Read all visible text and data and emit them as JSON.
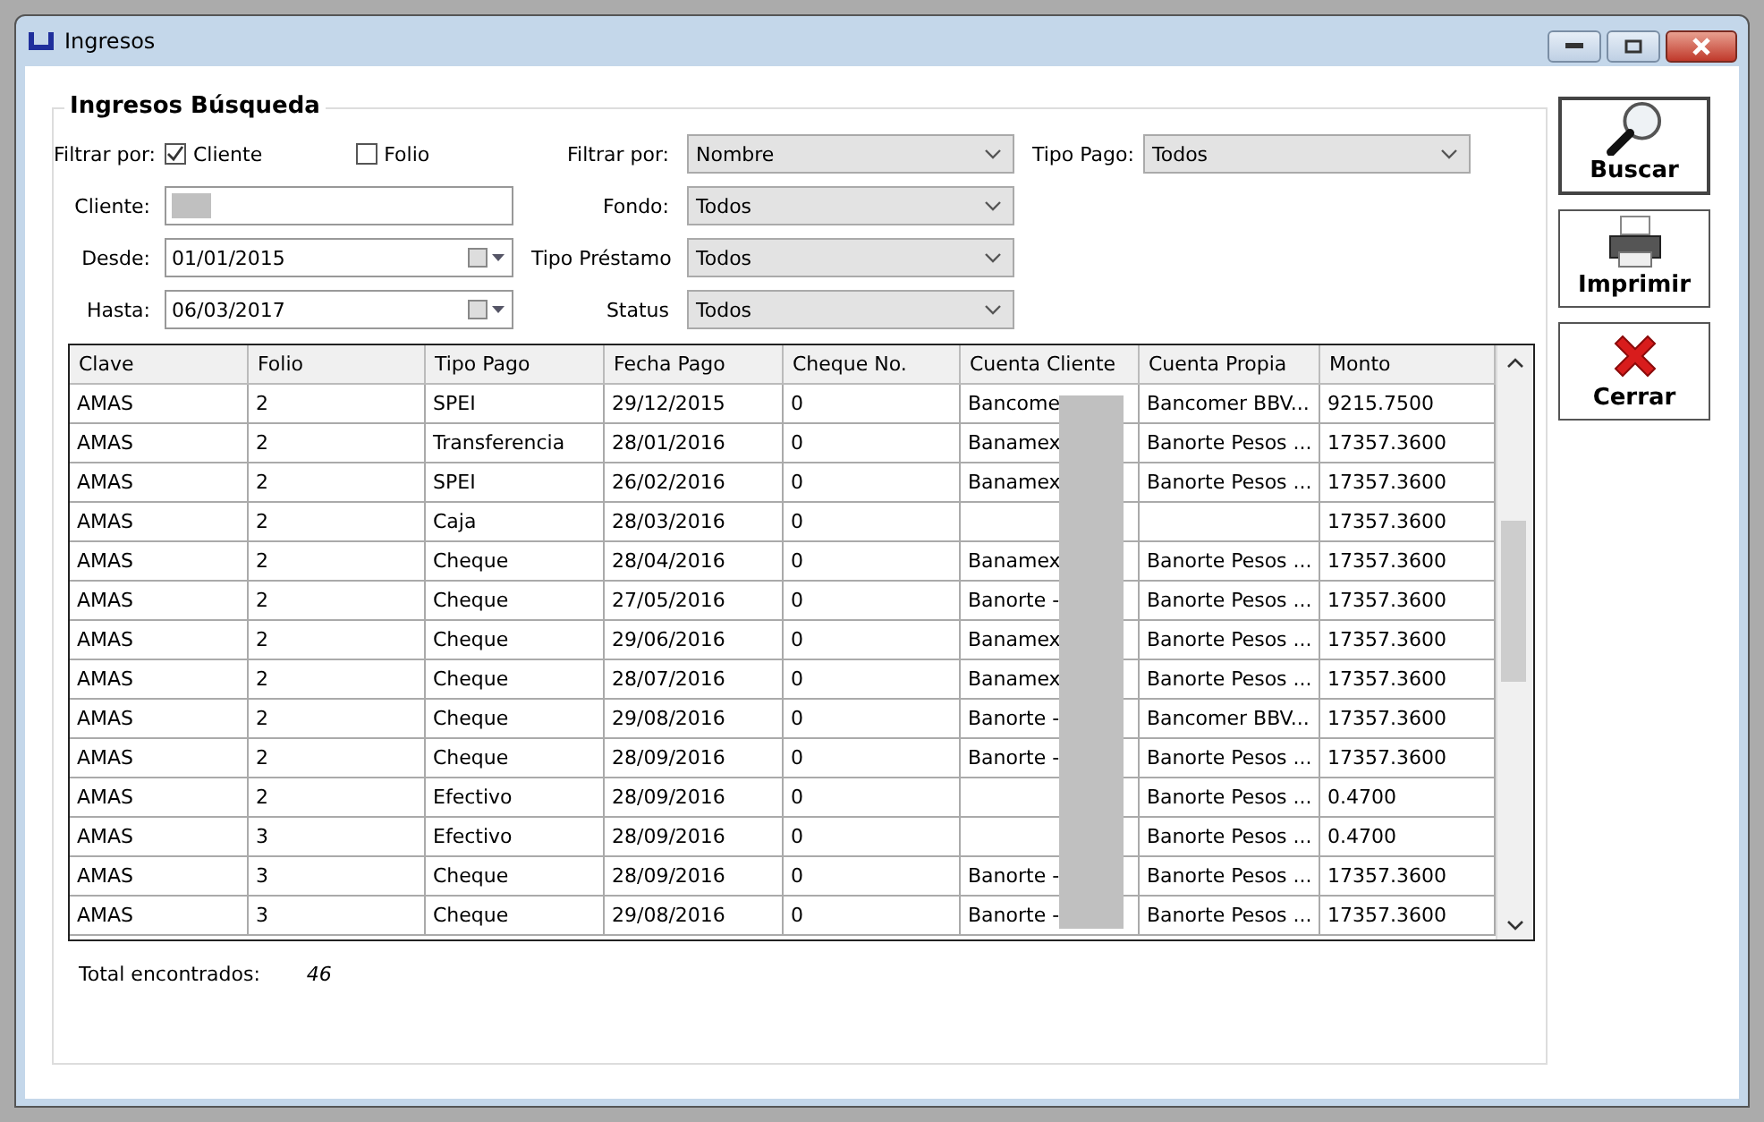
{
  "window": {
    "title": "Ingresos"
  },
  "group": {
    "title": "Ingresos Búsqueda"
  },
  "filters": {
    "filter_label": "Filtrar por:",
    "options": [
      {
        "label": "Cliente",
        "checked": true
      },
      {
        "label": "Folio",
        "checked": false
      }
    ],
    "cliente_label": "Cliente:",
    "desde_label": "Desde:",
    "desde_value": "01/01/2015",
    "hasta_label": "Hasta:",
    "hasta_value": "06/03/2017",
    "combos": [
      {
        "label": "Filtrar por:",
        "value": "Nombre"
      },
      {
        "label": "Fondo:",
        "value": "Todos"
      },
      {
        "label": "Tipo Préstamo",
        "value": "Todos"
      },
      {
        "label": "Status",
        "value": "Todos"
      }
    ],
    "tipo_pago": {
      "label": "Tipo Pago:",
      "value": "Todos"
    }
  },
  "table": {
    "columns": [
      "Clave",
      "Folio",
      "Tipo Pago",
      "Fecha Pago",
      "Cheque No.",
      "Cuenta Cliente",
      "Cuenta Propia",
      "Monto"
    ],
    "rows": [
      [
        "AMAS",
        "2",
        "SPEI",
        "29/12/2015",
        "0",
        "Bancome",
        "Bancomer BBV...",
        "9215.7500"
      ],
      [
        "AMAS",
        "2",
        "Transferencia",
        "28/01/2016",
        "0",
        "Banamex",
        "Banorte Pesos ...",
        "17357.3600"
      ],
      [
        "AMAS",
        "2",
        "SPEI",
        "26/02/2016",
        "0",
        "Banamex",
        "Banorte Pesos ...",
        "17357.3600"
      ],
      [
        "AMAS",
        "2",
        "Caja",
        "28/03/2016",
        "0",
        "",
        "",
        "17357.3600"
      ],
      [
        "AMAS",
        "2",
        "Cheque",
        "28/04/2016",
        "0",
        "Banamex",
        "Banorte Pesos ...",
        "17357.3600"
      ],
      [
        "AMAS",
        "2",
        "Cheque",
        "27/05/2016",
        "0",
        "Banorte -",
        "Banorte Pesos ...",
        "17357.3600"
      ],
      [
        "AMAS",
        "2",
        "Cheque",
        "29/06/2016",
        "0",
        "Banamex",
        "Banorte Pesos ...",
        "17357.3600"
      ],
      [
        "AMAS",
        "2",
        "Cheque",
        "28/07/2016",
        "0",
        "Banamex",
        "Banorte Pesos ...",
        "17357.3600"
      ],
      [
        "AMAS",
        "2",
        "Cheque",
        "29/08/2016",
        "0",
        "Banorte -",
        "Bancomer BBV...",
        "17357.3600"
      ],
      [
        "AMAS",
        "2",
        "Cheque",
        "28/09/2016",
        "0",
        "Banorte -",
        "Banorte Pesos ...",
        "17357.3600"
      ],
      [
        "AMAS",
        "2",
        "Efectivo",
        "28/09/2016",
        "0",
        "",
        "Banorte Pesos ...",
        "0.4700"
      ],
      [
        "AMAS",
        "3",
        "Efectivo",
        "28/09/2016",
        "0",
        "",
        "Banorte Pesos ...",
        "0.4700"
      ],
      [
        "AMAS",
        "3",
        "Cheque",
        "28/09/2016",
        "0",
        "Banorte -",
        "Banorte Pesos ...",
        "17357.3600"
      ],
      [
        "AMAS",
        "3",
        "Cheque",
        "29/08/2016",
        "0",
        "Banorte -",
        "Banorte Pesos ...",
        "17357.3600"
      ]
    ]
  },
  "total": {
    "label": "Total encontrados:",
    "value": "46"
  },
  "buttons": [
    {
      "kind": "search",
      "label": "Buscar"
    },
    {
      "kind": "print",
      "label": "Imprimir"
    },
    {
      "kind": "close",
      "label": "Cerrar"
    }
  ]
}
